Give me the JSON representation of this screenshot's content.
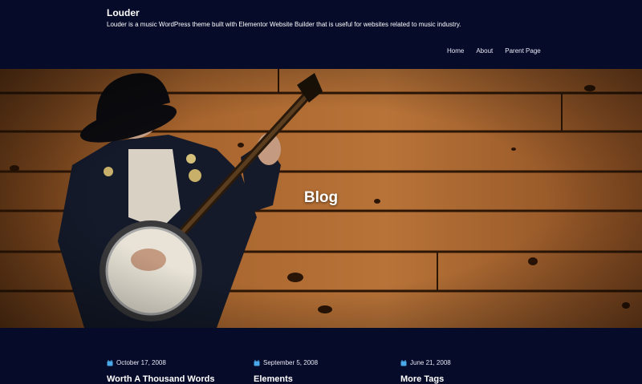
{
  "site": {
    "title": "Louder",
    "tagline": "Louder is a music WordPress theme built with Elementor Website Builder that is useful for websites related to music industry."
  },
  "nav": [
    {
      "label": "Home"
    },
    {
      "label": "About"
    },
    {
      "label": "Parent Page"
    }
  ],
  "hero": {
    "title": "Blog"
  },
  "posts": [
    {
      "date": "October 17, 2008",
      "title": "Worth A Thousand Words"
    },
    {
      "date": "September 5, 2008",
      "title": "Elements"
    },
    {
      "date": "June 21, 2008",
      "title": "More Tags"
    }
  ],
  "colors": {
    "background": "#070b2a",
    "accent": "#4aa8e8"
  }
}
